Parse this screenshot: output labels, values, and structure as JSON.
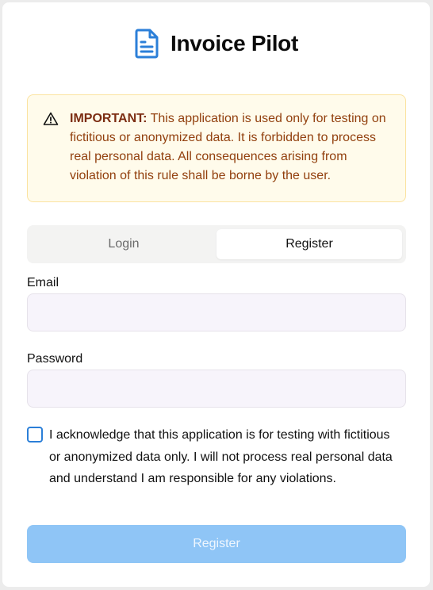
{
  "app": {
    "title": "Invoice Pilot",
    "logo_icon": "document-icon",
    "accent_color": "#2b7fd8"
  },
  "alert": {
    "icon": "warning-triangle-icon",
    "strong": "IMPORTANT:",
    "text": " This application is used only for testing on fictitious or anonymized data. It is forbidden to process real personal data. All consequences arising from violation of this rule shall be borne by the user."
  },
  "tabs": [
    {
      "label": "Login",
      "active": false
    },
    {
      "label": "Register",
      "active": true
    }
  ],
  "form": {
    "email_label": "Email",
    "email_value": "",
    "password_label": "Password",
    "password_value": "",
    "acknowledge_checked": false,
    "acknowledge_text": "I acknowledge that this application is for testing with fictitious or anonymized data only. I will not process real personal data and understand I am responsible for any violations.",
    "submit_label": "Register",
    "submit_disabled": true
  }
}
